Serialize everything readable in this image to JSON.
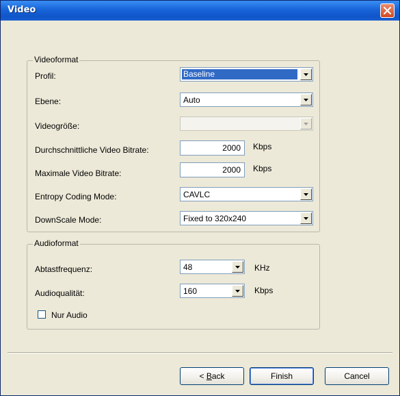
{
  "window": {
    "title": "Video"
  },
  "videoformat": {
    "legend": "Videoformat",
    "profil": {
      "label": "Profil:",
      "value": "Baseline"
    },
    "ebene": {
      "label": "Ebene:",
      "value": "Auto"
    },
    "videogroesse": {
      "label": "Videogröße:",
      "value": ""
    },
    "avg_bitrate": {
      "label": "Durchschnittliche Video Bitrate:",
      "value": "2000",
      "unit": "Kbps"
    },
    "max_bitrate": {
      "label": "Maximale Video Bitrate:",
      "value": "2000",
      "unit": "Kbps"
    },
    "entropy": {
      "label": "Entropy Coding Mode:",
      "value": "CAVLC"
    },
    "downscale": {
      "label": "DownScale Mode:",
      "value": "Fixed to 320x240"
    }
  },
  "audioformat": {
    "legend": "Audioformat",
    "abtast": {
      "label": "Abtastfrequenz:",
      "value": "48",
      "unit": "KHz"
    },
    "qualitaet": {
      "label": "Audioqualität:",
      "value": "160",
      "unit": "Kbps"
    },
    "nur_audio": {
      "label": "Nur Audio",
      "checked": false
    }
  },
  "buttons": {
    "back_prefix": "< ",
    "back_accel": "B",
    "back_rest": "ack",
    "finish": "Finish",
    "cancel": "Cancel"
  }
}
